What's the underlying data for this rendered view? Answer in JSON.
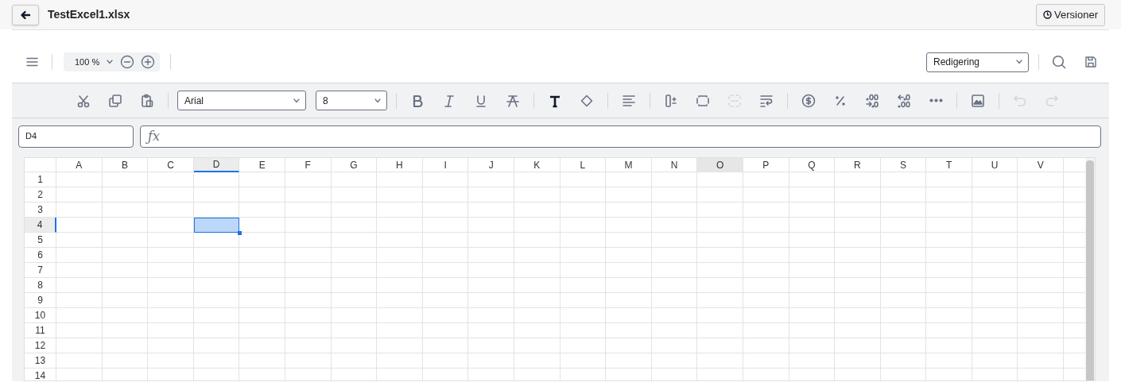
{
  "header": {
    "title": "TestExcel1.xlsx",
    "versions_button": "Versioner"
  },
  "toolbar": {
    "zoom": "100 %",
    "mode": "Redigering"
  },
  "format_bar": {
    "font": "Arial",
    "size": "8",
    "tool_groups": [
      [
        {
          "kind": "cut",
          "disabled": false
        },
        {
          "kind": "copy",
          "disabled": false
        },
        {
          "kind": "paste",
          "disabled": false
        }
      ],
      [
        {
          "kind": "bold",
          "disabled": false
        },
        {
          "kind": "italic",
          "disabled": false
        },
        {
          "kind": "underline",
          "disabled": false
        },
        {
          "kind": "strikethrough",
          "disabled": false
        }
      ],
      [
        {
          "kind": "text-color",
          "disabled": false
        },
        {
          "kind": "fill",
          "disabled": false
        }
      ],
      [
        {
          "kind": "align",
          "disabled": false
        }
      ],
      [
        {
          "kind": "row-height",
          "disabled": false
        },
        {
          "kind": "cell-size",
          "disabled": false
        },
        {
          "kind": "merge",
          "disabled": true
        },
        {
          "kind": "wrap",
          "disabled": false
        }
      ],
      [
        {
          "kind": "currency",
          "disabled": false
        },
        {
          "kind": "percent",
          "disabled": false
        },
        {
          "kind": "decimal-decrease",
          "disabled": false
        },
        {
          "kind": "decimal-increase",
          "disabled": false
        },
        {
          "kind": "more",
          "disabled": false
        }
      ],
      [
        {
          "kind": "image",
          "disabled": false
        }
      ],
      [
        {
          "kind": "undo",
          "disabled": true
        },
        {
          "kind": "redo",
          "disabled": true
        }
      ]
    ]
  },
  "formula_bar": {
    "name_box": "D4",
    "function_symbol": "ƒx"
  },
  "sheet": {
    "columns": [
      {
        "label": "A",
        "selected": false,
        "hovered": false
      },
      {
        "label": "B",
        "selected": false,
        "hovered": false
      },
      {
        "label": "C",
        "selected": false,
        "hovered": false
      },
      {
        "label": "D",
        "selected": true,
        "hovered": false
      },
      {
        "label": "E",
        "selected": false,
        "hovered": false
      },
      {
        "label": "F",
        "selected": false,
        "hovered": false
      },
      {
        "label": "G",
        "selected": false,
        "hovered": false
      },
      {
        "label": "H",
        "selected": false,
        "hovered": false
      },
      {
        "label": "I",
        "selected": false,
        "hovered": false
      },
      {
        "label": "J",
        "selected": false,
        "hovered": false
      },
      {
        "label": "K",
        "selected": false,
        "hovered": false
      },
      {
        "label": "L",
        "selected": false,
        "hovered": false
      },
      {
        "label": "M",
        "selected": false,
        "hovered": false
      },
      {
        "label": "N",
        "selected": false,
        "hovered": false
      },
      {
        "label": "O",
        "selected": false,
        "hovered": true
      },
      {
        "label": "P",
        "selected": false,
        "hovered": false
      },
      {
        "label": "Q",
        "selected": false,
        "hovered": false
      },
      {
        "label": "R",
        "selected": false,
        "hovered": false
      },
      {
        "label": "S",
        "selected": false,
        "hovered": false
      },
      {
        "label": "T",
        "selected": false,
        "hovered": false
      },
      {
        "label": "U",
        "selected": false,
        "hovered": false
      },
      {
        "label": "V",
        "selected": false,
        "hovered": false
      }
    ],
    "rows": [
      {
        "label": "1",
        "selected": false
      },
      {
        "label": "2",
        "selected": false
      },
      {
        "label": "3",
        "selected": false
      },
      {
        "label": "4",
        "selected": true
      },
      {
        "label": "5",
        "selected": false
      },
      {
        "label": "6",
        "selected": false
      },
      {
        "label": "7",
        "selected": false
      },
      {
        "label": "8",
        "selected": false
      },
      {
        "label": "9",
        "selected": false
      },
      {
        "label": "10",
        "selected": false
      },
      {
        "label": "11",
        "selected": false
      },
      {
        "label": "12",
        "selected": false
      },
      {
        "label": "13",
        "selected": false
      },
      {
        "label": "14",
        "selected": false
      }
    ]
  }
}
